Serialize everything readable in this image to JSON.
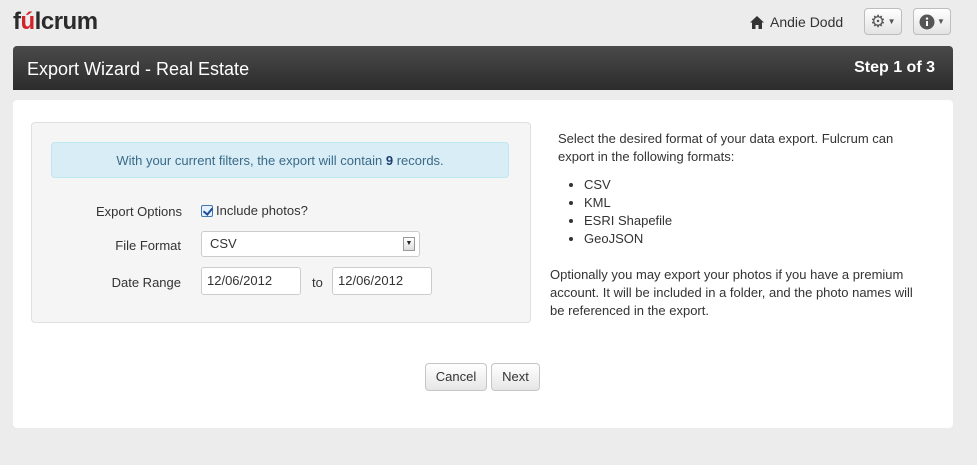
{
  "brand": {
    "logo_text_a": "f",
    "logo_text_hi": "ú",
    "logo_text_b": "lcrum"
  },
  "topbar": {
    "user_name": "Andie Dodd",
    "settings_icon": "gear-icon",
    "info_icon": "info-icon"
  },
  "header": {
    "title": "Export Wizard - Real Estate",
    "step": "Step 1 of 3"
  },
  "filter_notice": {
    "prefix": "With your current filters, the export will contain",
    "count": "9",
    "suffix": "records."
  },
  "form": {
    "export_options_label": "Export Options",
    "include_photos_label": "Include photos?",
    "include_photos_checked": true,
    "file_format_label": "File Format",
    "file_format_value": "CSV",
    "date_range_label": "Date Range",
    "date_from": "12/06/2012",
    "date_to_label": "to",
    "date_to": "12/06/2012"
  },
  "help": {
    "intro": "Select the desired format of your data export. Fulcrum can export in the following formats:",
    "formats": [
      "CSV",
      "KML",
      "ESRI Shapefile",
      "GeoJSON"
    ],
    "photos_note": "Optionally you may export your photos if you have a premium account. It will be included in a folder, and the photo names will be referenced in the export."
  },
  "actions": {
    "cancel": "Cancel",
    "next": "Next"
  }
}
